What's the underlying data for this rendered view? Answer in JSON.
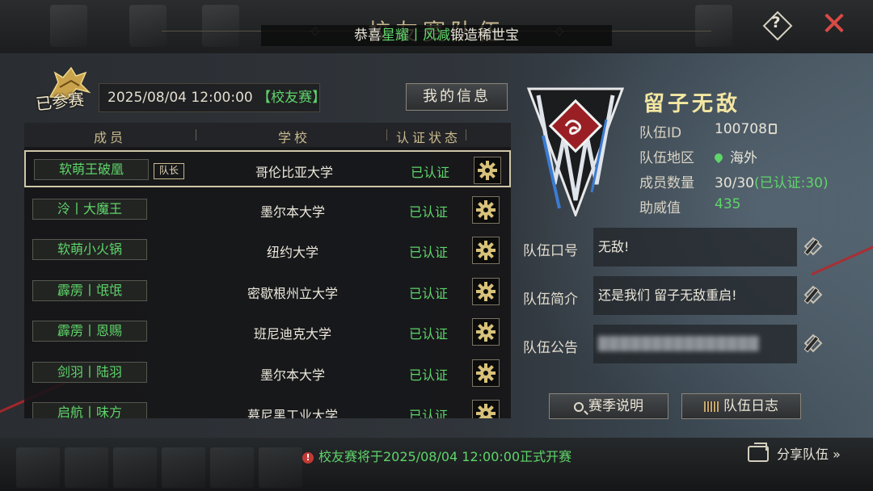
{
  "header": {
    "title": "校友赛队伍",
    "marquee": {
      "prefix": "恭喜",
      "player": "星耀丨风减",
      "suffix": "锻造稀世宝"
    },
    "help_icon": "help-question-icon",
    "close_icon": "close-x-icon"
  },
  "status": {
    "badge": "已参赛",
    "date": "2025/08/04 12:00:00",
    "event_tag": "【校友赛】"
  },
  "my_info_label": "我的信息",
  "table": {
    "columns": [
      "成员",
      "学校",
      "认证状态"
    ],
    "captain_tag": "队长",
    "rows": [
      {
        "member": "软萌王破凰",
        "school": "哥伦比亚大学",
        "status": "已认证",
        "captain": true
      },
      {
        "member": "泠丨大魔王",
        "school": "墨尔本大学",
        "status": "已认证"
      },
      {
        "member": "软萌小火锅",
        "school": "纽约大学",
        "status": "已认证"
      },
      {
        "member": "霹雳丨氓氓",
        "school": "密歇根州立大学",
        "status": "已认证"
      },
      {
        "member": "霹雳丨恩赐",
        "school": "班尼迪克大学",
        "status": "已认证"
      },
      {
        "member": "剑羽丨陆羽",
        "school": "墨尔本大学",
        "status": "已认证"
      },
      {
        "member": "启航丨味方",
        "school": "慕尼黑工业大学",
        "status": "已认证"
      }
    ]
  },
  "team": {
    "name": "留子无敌",
    "id_label": "队伍ID",
    "id": "100708",
    "region_label": "队伍地区",
    "region": "海外",
    "members_label": "成员数量",
    "members": "30/30",
    "members_certified": "(已认证:30)",
    "support_label": "助威值",
    "support": "435"
  },
  "fields": {
    "slogan_label": "队伍口号",
    "slogan": "无敌!",
    "intro_label": "队伍简介",
    "intro": "还是我们 留子无敌重启!",
    "notice_label": "队伍公告",
    "notice": "███████████████"
  },
  "buttons": {
    "season": "赛季说明",
    "log": "队伍日志"
  },
  "footer": {
    "notice": "校友赛将于2025/08/04 12:00:00正式开赛",
    "share": "分享队伍 »"
  },
  "colors": {
    "accent_green": "#5fd56a",
    "gold": "#c9b98e",
    "team_name": "#f4e7a1",
    "close_red": "#d94a45"
  }
}
